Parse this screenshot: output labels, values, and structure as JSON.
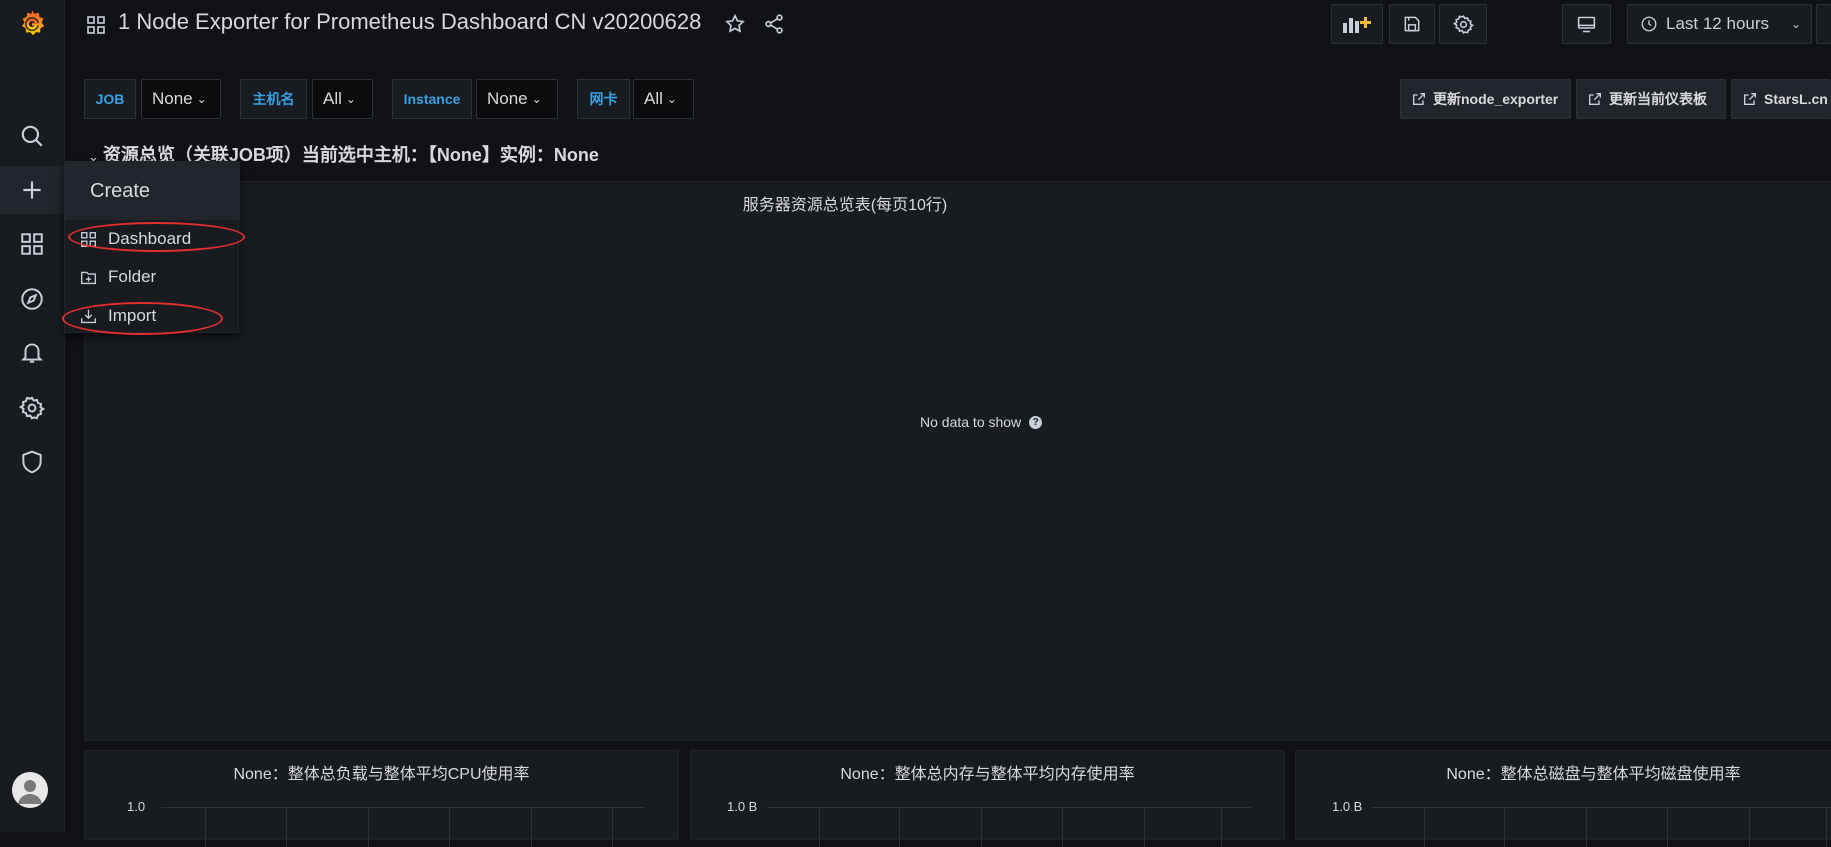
{
  "header": {
    "title": "1 Node Exporter for Prometheus Dashboard CN v20200628",
    "time_range": "Last 12 hours"
  },
  "variables": [
    {
      "label": "JOB",
      "value": "None"
    },
    {
      "label": "主机名",
      "value": "All"
    },
    {
      "label": "Instance",
      "value": "None"
    },
    {
      "label": "网卡",
      "value": "All"
    }
  ],
  "links": [
    {
      "label": "更新node_exporter"
    },
    {
      "label": "更新当前仪表板"
    },
    {
      "label": "StarsL.cn"
    }
  ],
  "row": {
    "title": "资源总览（关联JOB项）当前选中主机：【None】实例：None"
  },
  "main_panel": {
    "title": "服务器资源总览表(每页10行)",
    "empty_message": "No data to show"
  },
  "small_panels": [
    {
      "title": "None：整体总负载与整体平均CPU使用率",
      "y_tick": "1.0"
    },
    {
      "title": "None：整体总内存与整体平均内存使用率",
      "y_tick": "1.0 B"
    },
    {
      "title": "None：整体总磁盘与整体平均磁盘使用率",
      "y_tick": "1.0 B"
    }
  ],
  "create_menu": {
    "header": "Create",
    "items": [
      {
        "label": "Dashboard",
        "icon": "apps-icon"
      },
      {
        "label": "Folder",
        "icon": "folder-plus-icon"
      },
      {
        "label": "Import",
        "icon": "import-icon"
      }
    ]
  },
  "colors": {
    "background": "#111217",
    "panel": "#181b1f",
    "accent_blue": "#33a2e5",
    "annotation_red": "#e02f2f",
    "logo_orange": "#f46800"
  }
}
